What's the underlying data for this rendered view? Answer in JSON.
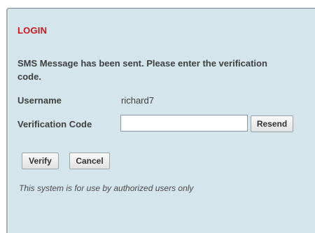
{
  "login": {
    "title": "LOGIN",
    "message": "SMS Message has been sent. Please enter the verification code.",
    "username_label": "Username",
    "username_value": "richard7",
    "code_label": "Verification Code",
    "code_value": "",
    "resend_label": "Resend",
    "verify_label": "Verify",
    "cancel_label": "Cancel",
    "notice": "This system is for use by authorized users only"
  },
  "colors": {
    "panel_background": "#d5e5ec",
    "title": "#d0161c",
    "text": "#3f3f3f"
  }
}
